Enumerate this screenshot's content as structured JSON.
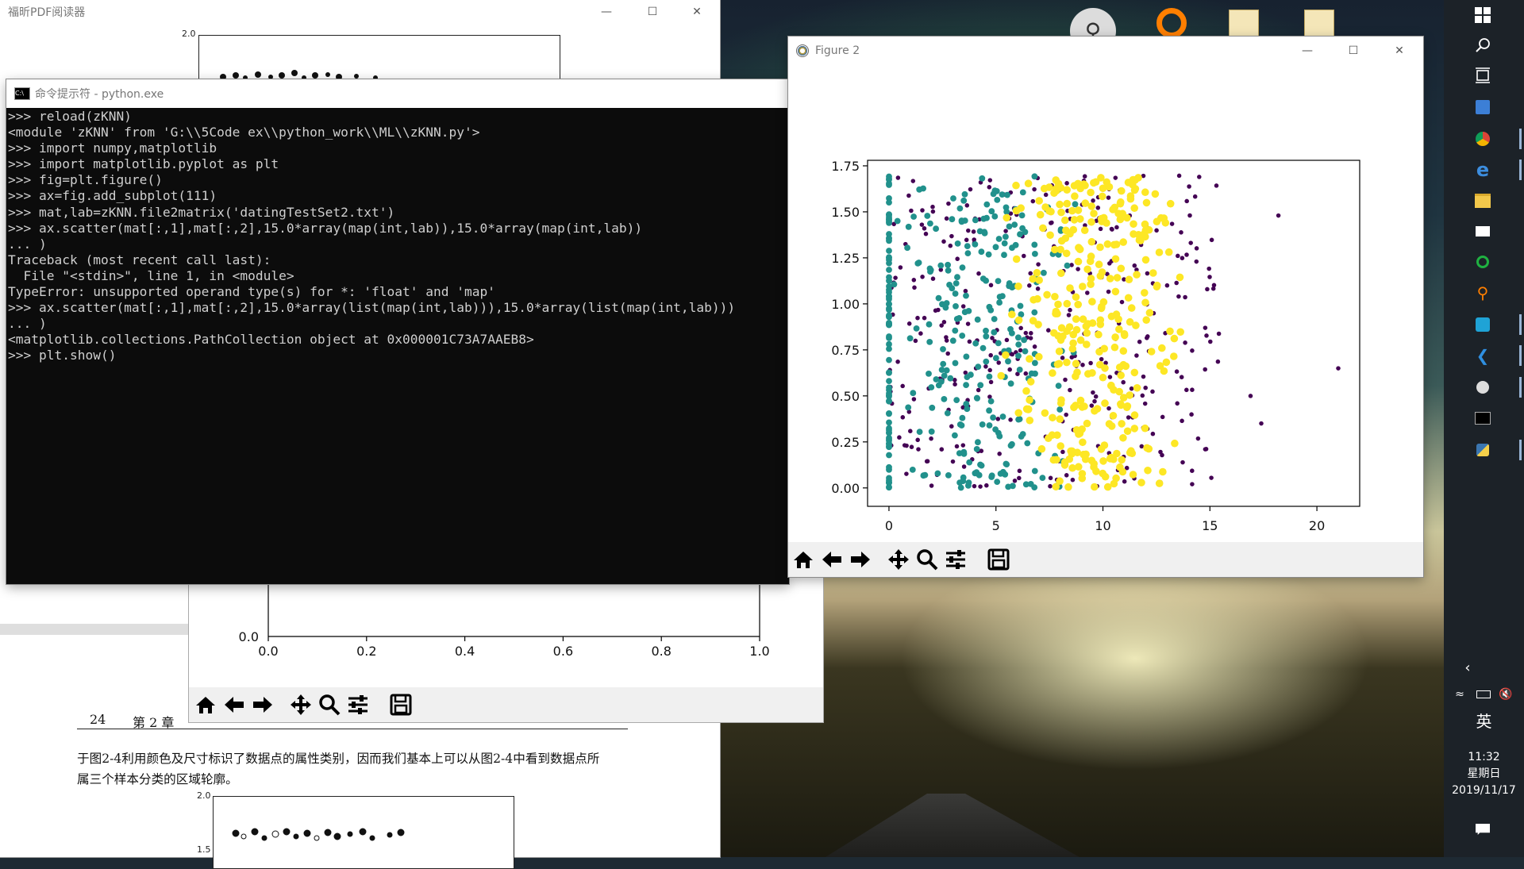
{
  "pdf_reader": {
    "title": "福昕PDF阅读器",
    "page_header": "24",
    "chapter": "第 2 章",
    "paragraph_line1": "于图2-4利用颜色及尺寸标识了数据点的属性类别，因而我们基本上可以从图2-4中看到数据点所",
    "paragraph_line2": "属三个样本分类的区域轮廓。",
    "top_plot_ytick": "2.0",
    "bottom_plot_yticks": [
      "2.0",
      "1.5"
    ]
  },
  "figure1": {
    "ytick": "0.0",
    "xticks": [
      "0.0",
      "0.2",
      "0.4",
      "0.6",
      "0.8",
      "1.0"
    ]
  },
  "console": {
    "title": "命令提示符 - python.exe",
    "lines": [
      ">>> reload(zKNN)",
      "<module 'zKNN' from 'G:\\\\5Code ex\\\\python_work\\\\ML\\\\zKNN.py'>",
      ">>> import numpy,matplotlib",
      ">>> import matplotlib.pyplot as plt",
      ">>> fig=plt.figure()",
      ">>> ax=fig.add_subplot(111)",
      ">>> mat,lab=zKNN.file2matrix('datingTestSet2.txt')",
      ">>> ax.scatter(mat[:,1],mat[:,2],15.0*array(map(int,lab)),15.0*array(map(int,lab))",
      "... )",
      "Traceback (most recent call last):",
      "  File \"<stdin>\", line 1, in <module>",
      "TypeError: unsupported operand type(s) for *: 'float' and 'map'",
      ">>> ax.scatter(mat[:,1],mat[:,2],15.0*array(list(map(int,lab))),15.0*array(list(map(int,lab)))",
      "... )",
      "<matplotlib.collections.PathCollection object at 0x000001C73A7AAEB8>",
      ">>> plt.show()"
    ]
  },
  "figure2": {
    "title": "Figure 2"
  },
  "chart_data": {
    "type": "scatter",
    "xlim": [
      -1,
      22
    ],
    "ylim": [
      -0.1,
      1.78
    ],
    "xticks": [
      0,
      5,
      10,
      15,
      20
    ],
    "yticks": [
      0.0,
      0.25,
      0.5,
      0.75,
      1.0,
      1.25,
      1.5,
      1.75
    ],
    "xtick_labels": [
      "0",
      "5",
      "10",
      "15",
      "20"
    ],
    "ytick_labels": [
      "0.00",
      "0.25",
      "0.50",
      "0.75",
      "1.00",
      "1.25",
      "1.50",
      "1.75"
    ],
    "grid": false,
    "series": [
      {
        "color": "#440154",
        "point_size": 15,
        "x_range": [
          0,
          21
        ],
        "y_range": [
          0,
          1.7
        ],
        "count": 340,
        "sample": [
          [
            21.0,
            0.65
          ],
          [
            18.2,
            1.48
          ],
          [
            17.4,
            0.35
          ],
          [
            16.9,
            0.5
          ],
          [
            14.5,
            1.69
          ],
          [
            13.0,
            1.1
          ]
        ]
      },
      {
        "color": "#21918c",
        "point_size": 30,
        "x_range": [
          0,
          9
        ],
        "y_range": [
          0,
          1.7
        ],
        "count": 330,
        "sample": [
          [
            0.0,
            1.68
          ],
          [
            0.0,
            0.03
          ],
          [
            3.0,
            0.8
          ],
          [
            5.5,
            1.5
          ]
        ]
      },
      {
        "color": "#fde725",
        "point_size": 45,
        "x_range": [
          5,
          14
        ],
        "y_range": [
          0,
          1.7
        ],
        "count": 330,
        "sample": [
          [
            10.0,
            0.6
          ],
          [
            12.0,
            1.4
          ],
          [
            8.5,
            0.2
          ]
        ]
      }
    ]
  },
  "taskbar": {
    "ime": "英",
    "time": "11:32",
    "weekday": "星期日",
    "date": "2019/11/17"
  },
  "icons": {
    "window_controls": [
      "minimize-icon",
      "maximize-icon",
      "close-icon"
    ],
    "toolbar": [
      "home-icon",
      "back-icon",
      "forward-icon",
      "pan-icon",
      "zoom-icon",
      "configure-icon",
      "save-icon"
    ]
  }
}
